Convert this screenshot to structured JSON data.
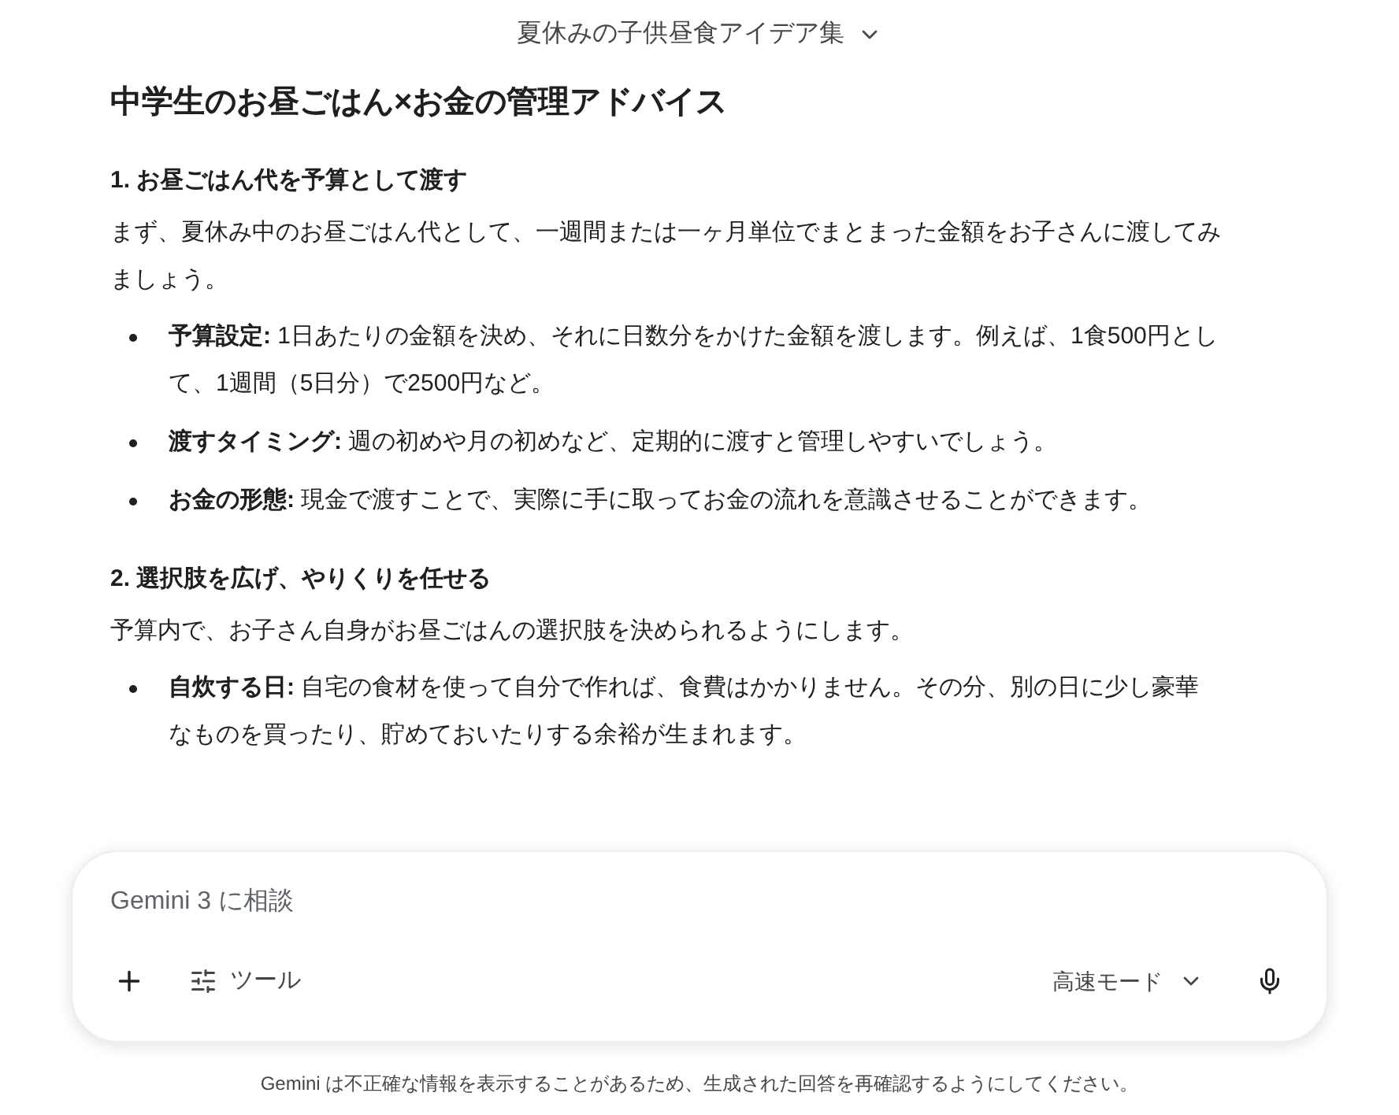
{
  "header": {
    "title": "夏休みの子供昼食アイデア集"
  },
  "heading": "中学生のお昼ごはん×お金の管理アドバイス",
  "sections": [
    {
      "title": "1. お昼ごはん代を予算として渡す",
      "intro": "まず、夏休み中のお昼ごはん代として、一週間または一ヶ月単位でまとまった金額をお子さんに渡してみましょう。",
      "bullets": [
        {
          "lead": "予算設定:",
          "text": "1日あたりの金額を決め、それに日数分をかけた金額を渡します。例えば、1食500円として、1週間（5日分）で2500円など。"
        },
        {
          "lead": "渡すタイミング:",
          "text": "週の初めや月の初めなど、定期的に渡すと管理しやすいでしょう。"
        },
        {
          "lead": "お金の形態:",
          "text": "現金で渡すことで、実際に手に取ってお金の流れを意識させることができます。"
        }
      ]
    },
    {
      "title": "2. 選択肢を広げ、やりくりを任せる",
      "intro": "予算内で、お子さん自身がお昼ごはんの選択肢を決められるようにします。",
      "bullets": [
        {
          "lead": "自炊する日:",
          "text": "自宅の食材を使って自分で作れば、食費はかかりません。その分、別の日に少し豪華なものを買ったり、貯めておいたりする余裕が生まれます。"
        }
      ]
    }
  ],
  "composer": {
    "placeholder": "Gemini 3 に相談",
    "tools_label": "ツール",
    "mode": "高速モード"
  },
  "footer": "Gemini は不正確な情報を表示することがあるため、生成された回答を再確認するようにしてください。"
}
